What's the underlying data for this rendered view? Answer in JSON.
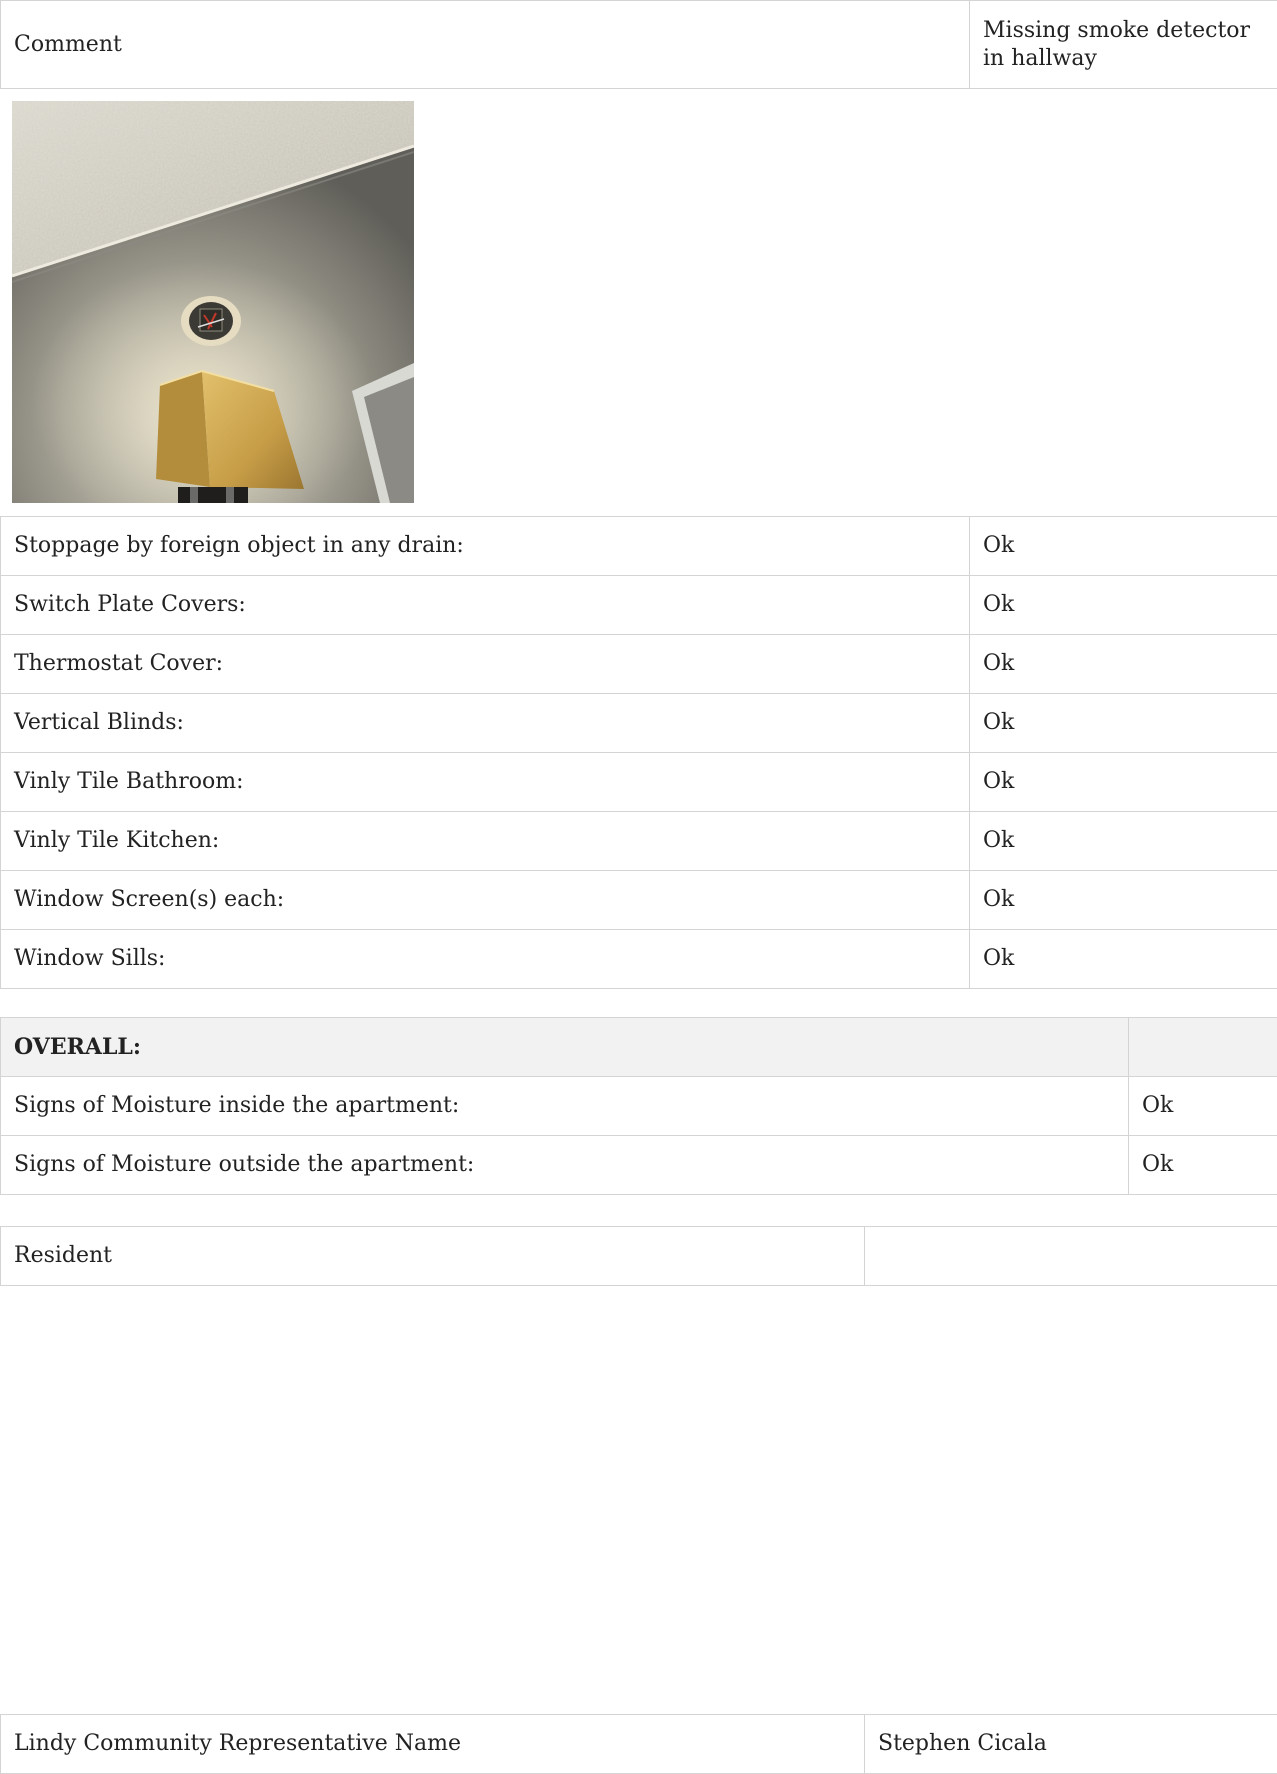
{
  "comment": {
    "label": "Comment",
    "value": "Missing smoke detector in hallway"
  },
  "items": [
    {
      "label": "Stoppage by foreign object in any drain:",
      "value": "Ok"
    },
    {
      "label": "Switch Plate Covers:",
      "value": "Ok"
    },
    {
      "label": "Thermostat Cover:",
      "value": "Ok"
    },
    {
      "label": "Vertical Blinds:",
      "value": "Ok"
    },
    {
      "label": "Vinly Tile Bathroom:",
      "value": "Ok"
    },
    {
      "label": "Vinly Tile Kitchen:",
      "value": "Ok"
    },
    {
      "label": "Window Screen(s) each:",
      "value": "Ok"
    },
    {
      "label": "Window Sills:",
      "value": "Ok"
    }
  ],
  "overall": {
    "heading": "OVERALL:",
    "rows": [
      {
        "label": "Signs of Moisture inside the apartment:",
        "value": "Ok"
      },
      {
        "label": "Signs of Moisture outside the apartment:",
        "value": "Ok"
      }
    ]
  },
  "resident": {
    "label": "Resident",
    "value": ""
  },
  "representative": {
    "label": "Lindy Community Representative Name",
    "value": "Stephen Cicala"
  },
  "colors": {
    "border": "#d4d4d4",
    "header_bg": "#f2f2f2",
    "text": "#222222"
  }
}
